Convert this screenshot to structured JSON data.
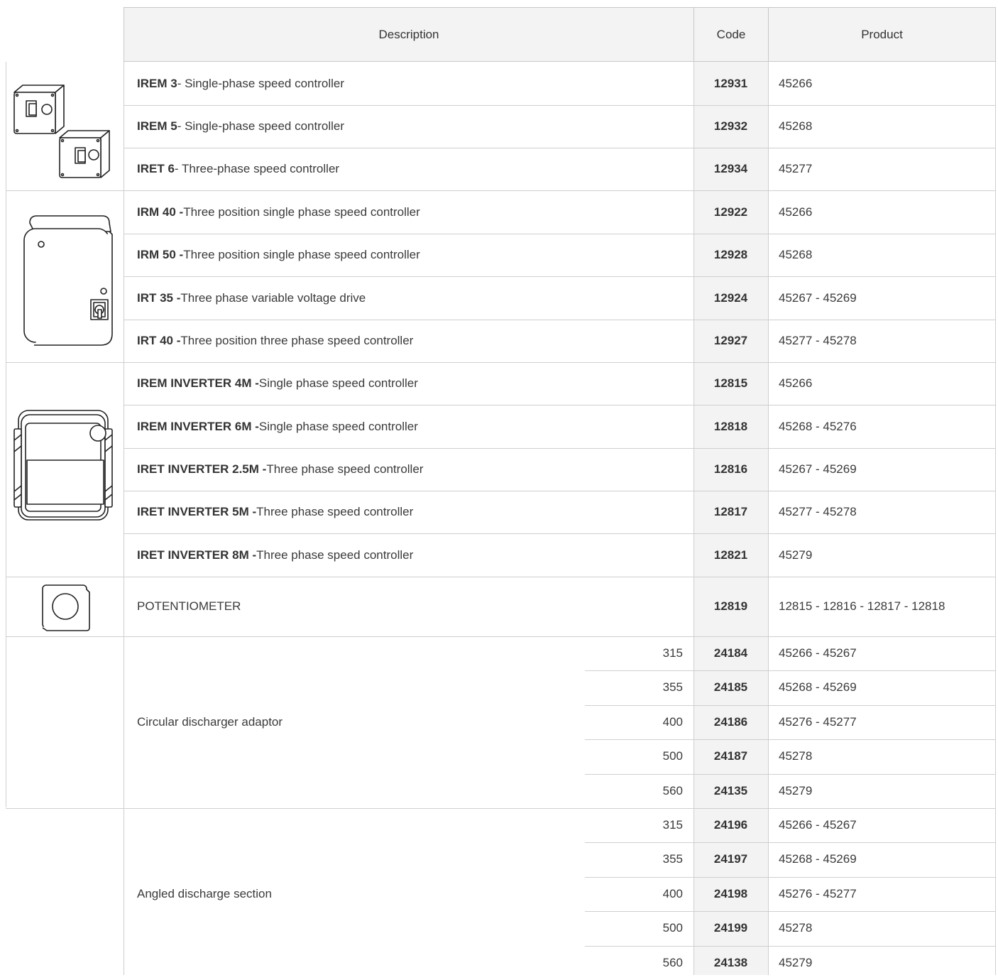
{
  "header": {
    "description": "Description",
    "code": "Code",
    "product": "Product"
  },
  "groups": [
    {
      "rows": [
        {
          "name": "IREM 3",
          "desc": " - Single-phase speed controller",
          "code": "12931",
          "product": "45266"
        },
        {
          "name": "IREM 5",
          "desc": " - Single-phase speed controller",
          "code": "12932",
          "product": "45268"
        },
        {
          "name": "IRET 6",
          "desc": " - Three-phase speed controller",
          "code": "12934",
          "product": "45277"
        }
      ],
      "icon": "small-enclosure-boxes-icon"
    },
    {
      "rows": [
        {
          "name": "IRM 40 -",
          "desc": " Three position single phase speed controller",
          "code": "12922",
          "product": "45266"
        },
        {
          "name": "IRM 50 -",
          "desc": " Three position single phase speed controller",
          "code": "12928",
          "product": "45268"
        },
        {
          "name": "IRT 35 -",
          "desc": " Three phase variable voltage drive",
          "code": "12924",
          "product": "45267 - 45269"
        },
        {
          "name": "IRT 40 -",
          "desc": " Three position three phase speed controller",
          "code": "12927",
          "product": "45277 - 45278"
        }
      ],
      "icon": "wall-enclosure-switch-icon"
    },
    {
      "rows": [
        {
          "name": "IREM INVERTER 4M -",
          "desc": " Single phase speed controller",
          "code": "12815",
          "product": "45266"
        },
        {
          "name": "IREM INVERTER 6M -",
          "desc": " Single phase speed controller",
          "code": "12818",
          "product": "45268 - 45276"
        },
        {
          "name": "IRET INVERTER 2.5M -",
          "desc": " Three phase speed controller",
          "code": "12816",
          "product": "45267 - 45269"
        },
        {
          "name": "IRET INVERTER 5M -",
          "desc": " Three phase speed controller",
          "code": "12817",
          "product": "45277 - 45278"
        },
        {
          "name": "IRET INVERTER 8M -",
          "desc": " Three phase speed controller",
          "code": "12821",
          "product": "45279"
        }
      ],
      "icon": "inverter-unit-icon"
    },
    {
      "rows": [
        {
          "name": "",
          "desc": "POTENTIOMETER",
          "code": "12819",
          "product": "12815 - 12816 - 12817 - 12818"
        }
      ],
      "icon": "potentiometer-knob-icon"
    }
  ],
  "sized_groups": [
    {
      "label": "Circular discharger adaptor",
      "rows": [
        {
          "size": "315",
          "code": "24184",
          "product": "45266 - 45267"
        },
        {
          "size": "355",
          "code": "24185",
          "product": "45268 - 45269"
        },
        {
          "size": "400",
          "code": "24186",
          "product": "45276 - 45277"
        },
        {
          "size": "500",
          "code": "24187",
          "product": "45278"
        },
        {
          "size": "560",
          "code": "24135",
          "product": "45279"
        }
      ]
    },
    {
      "label": "Angled discharge section",
      "rows": [
        {
          "size": "315",
          "code": "24196",
          "product": "45266 - 45267"
        },
        {
          "size": "355",
          "code": "24197",
          "product": "45268 - 45269"
        },
        {
          "size": "400",
          "code": "24198",
          "product": "45276 - 45277"
        },
        {
          "size": "500",
          "code": "24199",
          "product": "45278"
        },
        {
          "size": "560",
          "code": "24138",
          "product": "45279"
        }
      ]
    }
  ],
  "colors": {
    "header_bg": "#f3f3f3",
    "code_bg": "#f3f3f3",
    "border": "#cfcfcf",
    "text": "#3a3a3a"
  }
}
